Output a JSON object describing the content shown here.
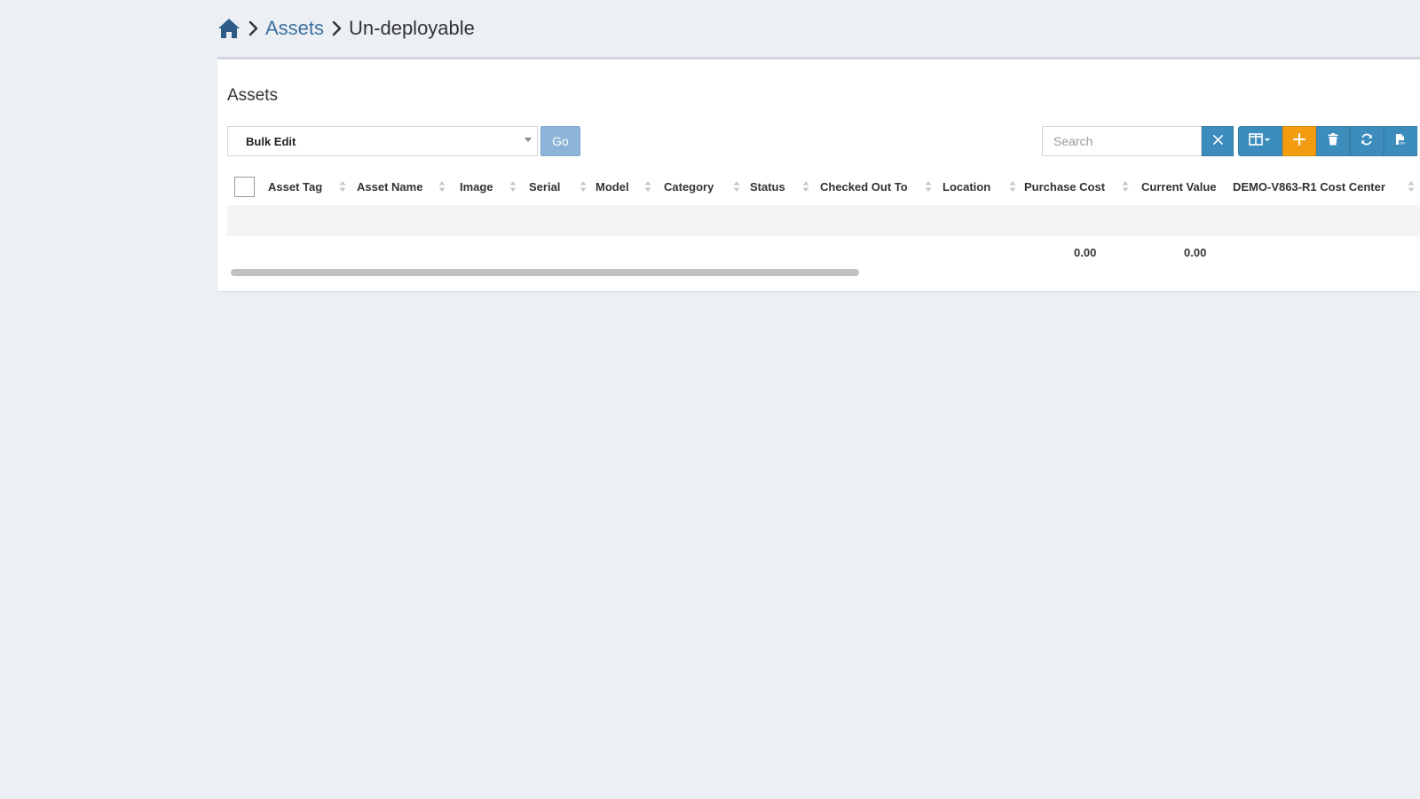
{
  "breadcrumb": {
    "home_icon": "home-icon",
    "separator_icon": "chevron-right-icon",
    "link_label": "Assets",
    "current_label": "Un-deployable"
  },
  "box": {
    "title": "Assets"
  },
  "bulk": {
    "selected": "Bulk Edit",
    "go_label": "Go"
  },
  "search": {
    "placeholder": "Search",
    "value": "",
    "clear_icon": "close-icon"
  },
  "toolbar": {
    "icons": [
      "columns-icon",
      "plus-icon",
      "trash-icon",
      "refresh-icon",
      "export-csv-icon"
    ]
  },
  "table": {
    "columns": [
      "Asset Tag",
      "Asset Name",
      "Image",
      "Serial",
      "Model",
      "Category",
      "Status",
      "Checked Out To",
      "Location",
      "Purchase Cost",
      "Current Value",
      "DEMO-V863-R1 Cost Center"
    ],
    "footer": {
      "purchase_cost": "0.00",
      "current_value": "0.00"
    }
  },
  "colors": {
    "primary": "#3c8dbc",
    "warning": "#f39c12",
    "link": "#3c6f9c",
    "background": "#ecf0f5"
  }
}
